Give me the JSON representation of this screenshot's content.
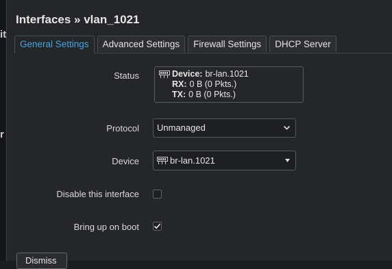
{
  "background_fragments": [
    "it",
    "r"
  ],
  "modal": {
    "title": "Interfaces » vlan_1021",
    "tabs": [
      {
        "label": "General Settings",
        "active": true
      },
      {
        "label": "Advanced Settings",
        "active": false
      },
      {
        "label": "Firewall Settings",
        "active": false
      },
      {
        "label": "DHCP Server",
        "active": false
      }
    ],
    "status": {
      "label": "Status",
      "device_key": "Device:",
      "device_value": "br-lan.1021",
      "rx_key": "RX:",
      "rx_value": "0 B (0 Pkts.)",
      "tx_key": "TX:",
      "tx_value": "0 B (0 Pkts.)"
    },
    "protocol": {
      "label": "Protocol",
      "value": "Unmanaged"
    },
    "device": {
      "label": "Device",
      "value": "br-lan.1021"
    },
    "disable_interface": {
      "label": "Disable this interface",
      "checked": false
    },
    "bring_up_on_boot": {
      "label": "Bring up on boot",
      "checked": true
    },
    "dismiss_label": "Dismiss"
  },
  "colors": {
    "accent": "#4aa3df",
    "background": "#242629"
  },
  "icons": [
    "network-port-icon",
    "chevron-down-icon",
    "caret-down-icon",
    "checkmark-icon"
  ]
}
